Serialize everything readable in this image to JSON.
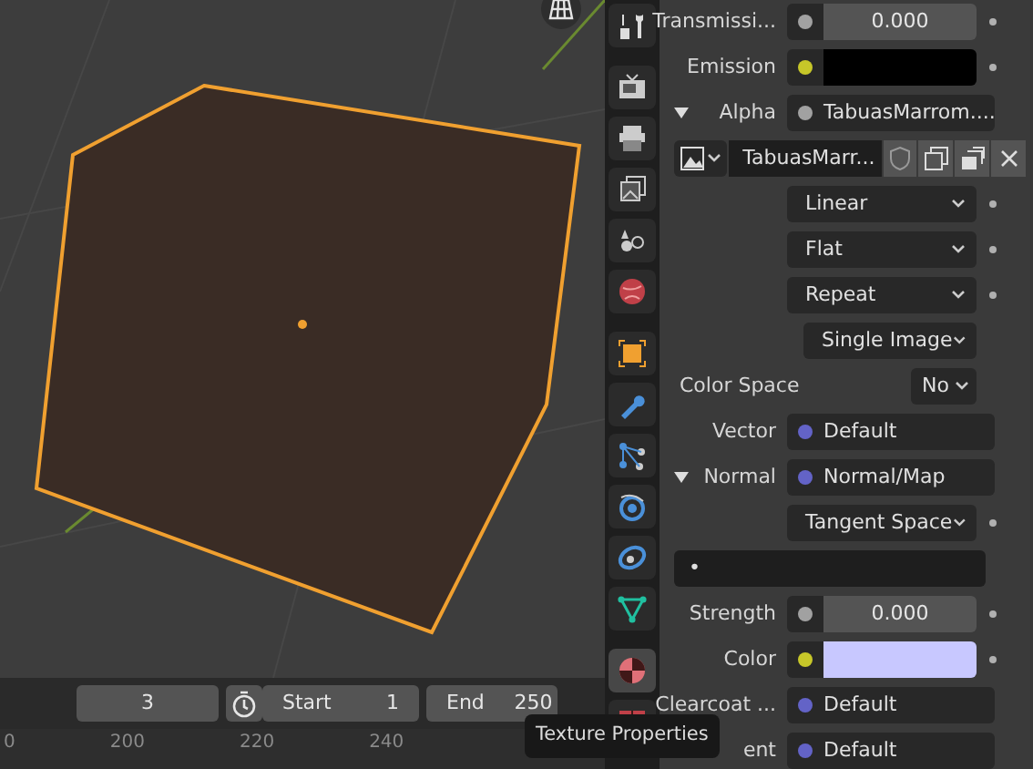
{
  "viewport": {
    "frame": "3",
    "start_label": "Start",
    "start": "1",
    "end_label": "End",
    "end": "250",
    "ruler": [
      "0",
      "200",
      "220",
      "240"
    ]
  },
  "tabs": [
    {
      "kind": "tool",
      "selected": false
    },
    {
      "kind": "render",
      "selected": false
    },
    {
      "kind": "output",
      "selected": false
    },
    {
      "kind": "view-layer",
      "selected": false
    },
    {
      "kind": "scene",
      "selected": false
    },
    {
      "kind": "world",
      "selected": false
    },
    {
      "kind": "object",
      "selected": false
    },
    {
      "kind": "modifier",
      "selected": false
    },
    {
      "kind": "particles",
      "selected": false
    },
    {
      "kind": "physics",
      "selected": false
    },
    {
      "kind": "constraints",
      "selected": false
    },
    {
      "kind": "data",
      "selected": false
    },
    {
      "kind": "material",
      "selected": true
    },
    {
      "kind": "texture",
      "selected": false
    }
  ],
  "rows": [
    {
      "kind": "value",
      "label": "Transmissi...",
      "color": "#a1a1a1",
      "value": "0.000"
    },
    {
      "kind": "color",
      "label": "Emission",
      "color": "#c7c729",
      "swatch": {
        "color": "#000000"
      }
    },
    {
      "kind": "link",
      "label": "Alpha",
      "color": "#a1a1a1",
      "value": "TabuasMarrom....",
      "expanded": true
    },
    {
      "kind": "image",
      "value": "TabuasMarr..."
    },
    {
      "kind": "dropdown",
      "value": "Linear",
      "dot": true
    },
    {
      "kind": "dropdown",
      "value": "Flat",
      "dot": true
    },
    {
      "kind": "dropdown",
      "value": "Repeat",
      "dot": true
    },
    {
      "kind": "dropdown",
      "value": "Single Image",
      "dot": false
    },
    {
      "kind": "labeled_dropdown",
      "label": "Color Space",
      "value": "No"
    },
    {
      "kind": "link",
      "label": "Vector",
      "color": "#6363c7",
      "value": "Default"
    },
    {
      "kind": "link",
      "label": "Normal",
      "color": "#6363c7",
      "value": "Normal/Map",
      "expanded": true
    },
    {
      "kind": "dropdown",
      "value": "Tangent Space",
      "dot": true
    },
    {
      "kind": "text",
      "value": "•"
    },
    {
      "kind": "value",
      "label": "Strength",
      "color": "#a1a1a1",
      "value": "0.000"
    },
    {
      "kind": "color",
      "label": "Color",
      "color": "#c7c729",
      "swatch": {
        "color": "#c8c8ff"
      }
    },
    {
      "kind": "link",
      "label": "Clearcoat ...",
      "color": "#6363c7",
      "value": "Default"
    },
    {
      "kind": "link",
      "label": "ent",
      "color": "#6363c7",
      "value": "Default"
    }
  ],
  "tooltip": "Texture Properties"
}
